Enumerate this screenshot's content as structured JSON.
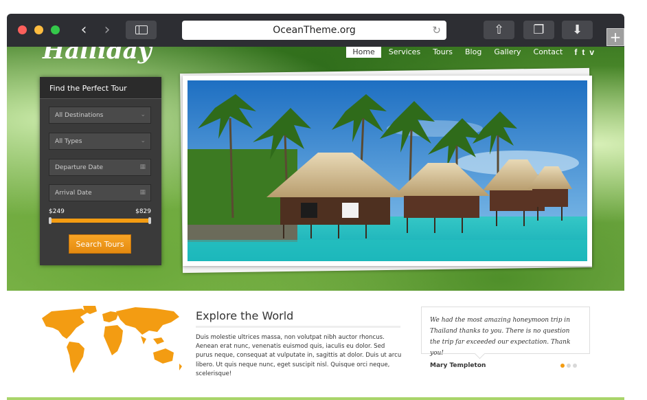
{
  "browser": {
    "url": "OceanTheme.org",
    "back_icon": "chevron-left-icon",
    "forward_icon": "chevron-right-icon",
    "new_tab_label": "+"
  },
  "site": {
    "logo": "Halliday",
    "nav": [
      "Home",
      "Services",
      "Tours",
      "Blog",
      "Gallery",
      "Contact"
    ],
    "active_nav": "Home",
    "social_icons": [
      "facebook-icon",
      "twitter-icon",
      "vimeo-icon"
    ]
  },
  "tour_search": {
    "title": "Find the Perfect Tour",
    "destination": "All Destinations",
    "type": "All Types",
    "departure_placeholder": "Departure Date",
    "arrival_placeholder": "Arrival Date",
    "price_min": "$249",
    "price_max": "$829",
    "price_range_fraction": [
      0.0,
      1.0
    ],
    "button": "Search Tours"
  },
  "explore": {
    "title": "Explore the World",
    "body": "Duis molestie ultrices massa, non volutpat nibh auctor rhoncus. Aenean erat nunc, venenatis euismod quis, iaculis eu dolor. Sed purus neque, consequat at vulputate in, sagittis at dolor. Duis ut arcu libero. Ut quis neque nunc, eget suscipit nisl. Quisque orci neque, scelerisque!"
  },
  "testimonial": {
    "quote": "We had the most amazing honeymoon trip in Thailand thanks to you. There is no question the trip far exceeded our expectation. Thank you!",
    "author": "Mary Templeton",
    "slides": 3,
    "active_slide": 1
  },
  "colors": {
    "accent": "#f39c12",
    "chrome": "#2d2e33",
    "widget": "#3a3a3a"
  }
}
